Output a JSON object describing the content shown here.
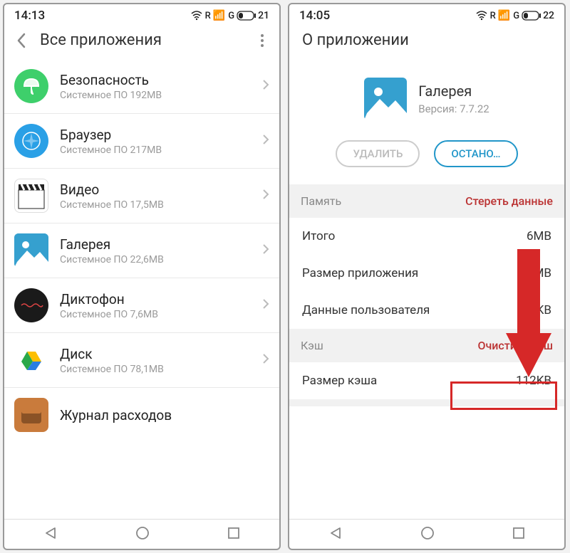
{
  "left": {
    "status": {
      "time": "14:13",
      "net_r": "R",
      "net_g": "G",
      "battery": "21"
    },
    "header": {
      "title": "Все приложения"
    },
    "apps": [
      {
        "name": "Безопасность",
        "sub": "Системное ПО  192MB",
        "icon": "umbrella",
        "bg": "#3ecf6b"
      },
      {
        "name": "Браузер",
        "sub": "Системное ПО  217MB",
        "icon": "compass",
        "bg": "#2aa0e6"
      },
      {
        "name": "Видео",
        "sub": "Системное ПО  17,5MB",
        "icon": "clapper",
        "bg": "#fff"
      },
      {
        "name": "Галерея",
        "sub": "Системное ПО  22,6MB",
        "icon": "gallery",
        "bg": "#35a0cf"
      },
      {
        "name": "Диктофон",
        "sub": "Системное ПО  7,6MB",
        "icon": "recorder",
        "bg": "#1a1a1a"
      },
      {
        "name": "Диск",
        "sub": "Системное ПО  78,1MB",
        "icon": "drive",
        "bg": "#fff"
      },
      {
        "name": "Журнал расходов",
        "sub": "",
        "icon": "wallet",
        "bg": "#c97b3c"
      }
    ]
  },
  "right": {
    "status": {
      "time": "14:05",
      "net_r": "R",
      "net_g": "G",
      "battery": "22"
    },
    "header": {
      "title": "О приложении"
    },
    "app": {
      "name": "Галерея",
      "version": "Версия: 7.7.22"
    },
    "buttons": {
      "uninstall": "УДАЛИТЬ",
      "stop": "ОСТАНО…"
    },
    "memory": {
      "label": "Память",
      "action": "Стереть данные",
      "rows": [
        {
          "k": "Итого",
          "v": "6MB"
        },
        {
          "k": "Размер приложения",
          "v": "MB"
        },
        {
          "k": "Данные пользователя",
          "v": "96KB"
        }
      ]
    },
    "cache": {
      "label": "Кэш",
      "action": "Очистить кэш",
      "rows": [
        {
          "k": "Размер кэша",
          "v": "112KB"
        }
      ]
    }
  }
}
